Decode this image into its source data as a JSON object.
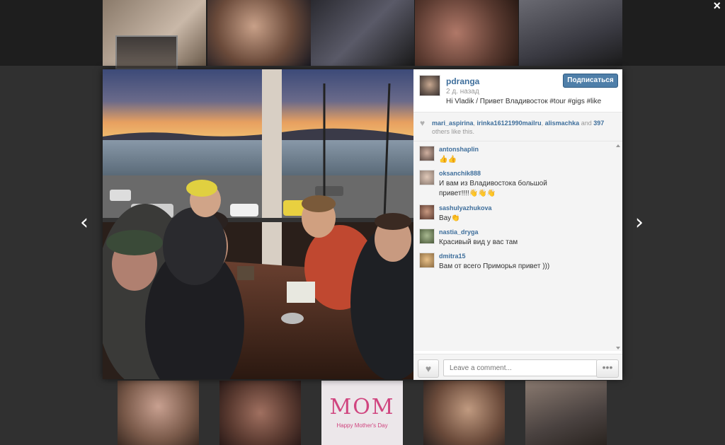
{
  "modal": {
    "close_label": "×",
    "prev_arrow": "‹",
    "next_arrow": "›"
  },
  "post": {
    "username": "pdranga",
    "time": "2 д. назад",
    "caption": "Hi Vladik / Привет Владивосток #tour #gigs #like",
    "follow_label": "Подписаться"
  },
  "likes": {
    "users": [
      "mari_aspirina",
      "irinka16121990mailru",
      "alismachka"
    ],
    "sep1": ", ",
    "sep2": ", ",
    "and_text": " and ",
    "count": "397",
    "suffix": "others like this."
  },
  "comments": [
    {
      "user": "antonshaplin",
      "text": "👍👍"
    },
    {
      "user": "oksanchik888",
      "text": "И вам из Владивостока большой привет!!!!👋👋👋"
    },
    {
      "user": "sashulyazhukova",
      "text": "Вау👏"
    },
    {
      "user": "nastia_dryga",
      "text": "Красивый вид  у вас там"
    },
    {
      "user": "dmitra15",
      "text": "Вам от всего Приморья привет )))"
    }
  ],
  "comment_input": {
    "placeholder": "Leave a comment..."
  },
  "more_label": "•••",
  "bottom_thumb_text": {
    "title": "MOM",
    "subtitle": "Happy Mother's Day"
  },
  "colors": {
    "link": "#3f6f9c",
    "follow_bg": "#4f7fa9",
    "panel_bg": "#f4f4f4",
    "mom_pink": "#d0457f"
  }
}
